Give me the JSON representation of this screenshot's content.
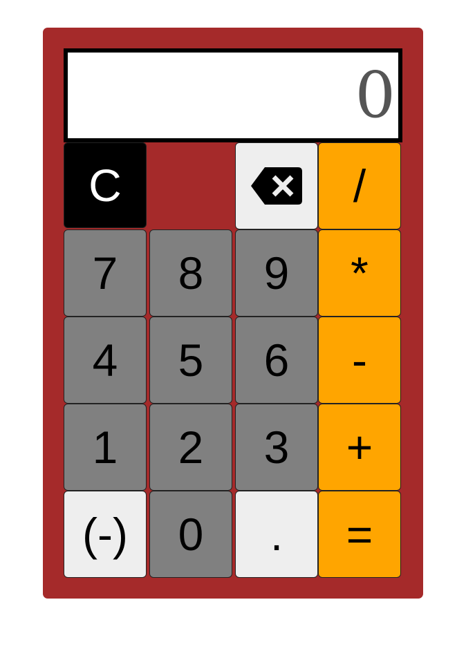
{
  "display": {
    "value": "0"
  },
  "keys": {
    "clear": "C",
    "backspace_icon": "backspace-icon",
    "divide": "/",
    "multiply": "*",
    "subtract": "-",
    "add": "+",
    "equals": "=",
    "seven": "7",
    "eight": "8",
    "nine": "9",
    "four": "4",
    "five": "5",
    "six": "6",
    "one": "1",
    "two": "2",
    "three": "3",
    "negate": "(-)",
    "zero": "0",
    "decimal": "."
  },
  "colors": {
    "body": "#a52a2a",
    "number_key": "#808080",
    "light_key": "#eeeeee",
    "operator_key": "#ffa500",
    "clear_key": "#000000"
  }
}
